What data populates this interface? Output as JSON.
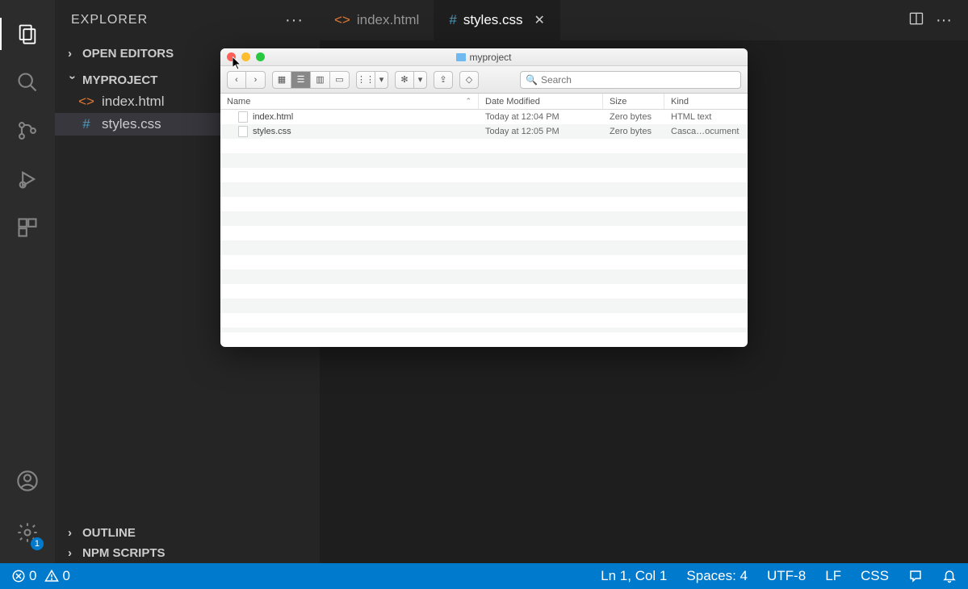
{
  "sidebar": {
    "title": "EXPLORER",
    "sections": {
      "open_editors": "OPEN EDITORS",
      "project": "MYPROJECT",
      "outline": "OUTLINE",
      "npm_scripts": "NPM SCRIPTS"
    },
    "files": [
      {
        "name": "index.html",
        "selected": false
      },
      {
        "name": "styles.css",
        "selected": true
      }
    ]
  },
  "tabs": [
    {
      "label": "index.html",
      "active": false
    },
    {
      "label": "styles.css",
      "active": true
    }
  ],
  "status": {
    "errors": "0",
    "warnings": "0",
    "position": "Ln 1, Col 1",
    "spaces": "Spaces: 4",
    "encoding": "UTF-8",
    "eol": "LF",
    "language": "CSS"
  },
  "finder": {
    "title": "myproject",
    "search_placeholder": "Search",
    "columns": {
      "name": "Name",
      "date": "Date Modified",
      "size": "Size",
      "kind": "Kind"
    },
    "rows": [
      {
        "name": "index.html",
        "date": "Today at 12:04 PM",
        "size": "Zero bytes",
        "kind": "HTML text"
      },
      {
        "name": "styles.css",
        "date": "Today at 12:05 PM",
        "size": "Zero bytes",
        "kind": "Casca…ocument"
      }
    ]
  },
  "activity": {
    "settings_badge": "1"
  }
}
